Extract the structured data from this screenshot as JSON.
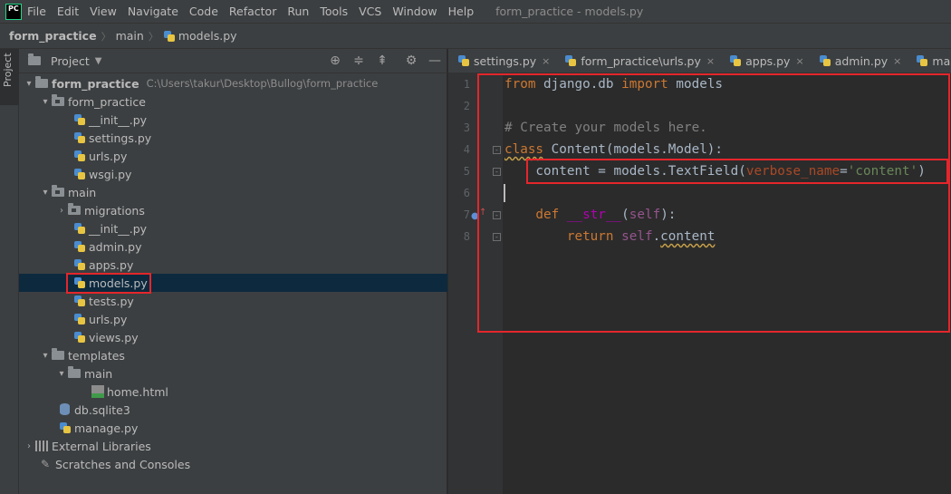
{
  "app": {
    "logo_text": "PC",
    "menu": [
      "File",
      "Edit",
      "View",
      "Navigate",
      "Code",
      "Refactor",
      "Run",
      "Tools",
      "VCS",
      "Window",
      "Help"
    ],
    "window_title": "form_practice - models.py"
  },
  "breadcrumb": {
    "project": "form_practice",
    "folder": "main",
    "file": "models.py"
  },
  "tool_strip": {
    "project_tab_label": "Project"
  },
  "project_panel": {
    "title": "Project",
    "root_name": "form_practice",
    "root_path": "C:\\Users\\takur\\Desktop\\Bullog\\form_practice",
    "items": [
      "form_practice",
      "__init__.py",
      "settings.py",
      "urls.py",
      "wsgi.py",
      "main",
      "migrations",
      "__init__.py",
      "admin.py",
      "apps.py",
      "models.py",
      "tests.py",
      "urls.py",
      "views.py",
      "templates",
      "main",
      "home.html",
      "db.sqlite3",
      "manage.py",
      "External Libraries",
      "Scratches and Consoles"
    ],
    "selected_item": "models.py"
  },
  "editor": {
    "tabs": [
      "settings.py",
      "form_practice\\urls.py",
      "apps.py",
      "admin.py",
      "main\\urls.py"
    ],
    "line_numbers": [
      "1",
      "2",
      "3",
      "4",
      "5",
      "6",
      "7",
      "8"
    ],
    "code": {
      "l1_from": "from",
      "l1_mod": " django.db ",
      "l1_import": "import",
      "l1_name": " models",
      "l3_comment": "# Create your models here.",
      "l4_class": "class",
      "l4_rest": " Content(models.Model):",
      "l5_a": "    content = models.TextField(",
      "l5_param": "verbose_name",
      "l5_eq": "=",
      "l5_str": "'content'",
      "l5_close": ")",
      "l7_def": "    def",
      "l7_sp": " ",
      "l7_fn": "__str__",
      "l7_paren_open": "(",
      "l7_self": "self",
      "l7_paren_close": "):",
      "l8_return": "        return",
      "l8_sp": " ",
      "l8_self": "self",
      "l8_dot": ".",
      "l8_attr": "content"
    }
  },
  "colors": {
    "highlight": "#e4262b",
    "keyword": "#cc7832",
    "string": "#6a8759",
    "comment": "#808080",
    "selected_row": "#0d293e"
  }
}
